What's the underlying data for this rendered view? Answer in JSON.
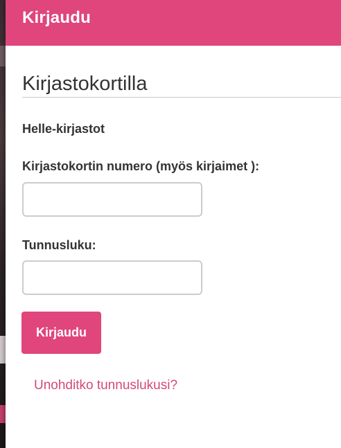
{
  "modal": {
    "title": "Kirjaudu"
  },
  "form": {
    "section_title": "Kirjastokortilla",
    "library_name": "Helle-kirjastot",
    "card_number_label": "Kirjastokortin numero (myös kirjaimet ):",
    "card_number_value": "",
    "pin_label": "Tunnusluku:",
    "pin_value": "",
    "submit_label": "Kirjaudu",
    "forgot_link": "Unohditko tunnuslukusi?"
  },
  "colors": {
    "accent": "#e0457b",
    "link": "#d4477c",
    "text": "#333333"
  }
}
